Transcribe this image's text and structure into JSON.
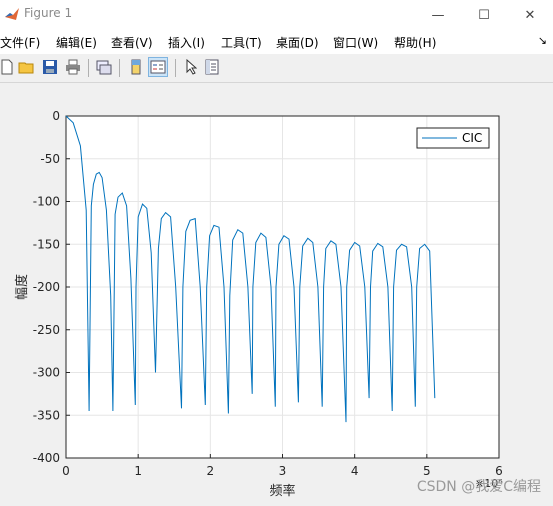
{
  "window": {
    "title": "Figure 1"
  },
  "window_controls": {
    "minimize": "—",
    "maximize": "☐",
    "close": "✕"
  },
  "menu": {
    "items": [
      "文件(F)",
      "编辑(E)",
      "查看(V)",
      "插入(I)",
      "工具(T)",
      "桌面(D)",
      "窗口(W)",
      "帮助(H)"
    ],
    "overflow": "↘"
  },
  "toolbar": {
    "buttons": [
      "new-figure-icon",
      "open-folder-icon",
      "save-icon",
      "print-icon",
      "link-plot-icon",
      "insert-colorbar-icon",
      "insert-legend-icon",
      "edit-plot-pointer-icon",
      "property-inspector-icon"
    ],
    "active": "insert-legend-icon"
  },
  "colors": {
    "line": "#0072bd",
    "grid": "#e6e6e6",
    "axes_bg": "#ffffff"
  },
  "chart_data": {
    "type": "line",
    "xlabel": "频率",
    "ylabel": "幅度",
    "xlim": [
      0,
      6
    ],
    "ylim": [
      -400,
      0
    ],
    "x_ticks": [
      "0",
      "1",
      "2",
      "3",
      "4",
      "5",
      "6"
    ],
    "y_ticks": [
      "0",
      "-50",
      "-100",
      "-150",
      "-200",
      "-250",
      "-300",
      "-350",
      "-400"
    ],
    "x_exponent": "×10⁶",
    "grid": true,
    "legend": {
      "entries": [
        "CIC"
      ],
      "placement": "top-right"
    },
    "series": [
      {
        "name": "CIC",
        "x": [
          0,
          0.1,
          0.2,
          0.28,
          0.32,
          0.35,
          0.38,
          0.42,
          0.46,
          0.5,
          0.56,
          0.62,
          0.65,
          0.68,
          0.72,
          0.78,
          0.84,
          0.9,
          0.96,
          0.97,
          1.0,
          1.06,
          1.12,
          1.18,
          1.24,
          1.28,
          1.32,
          1.38,
          1.45,
          1.52,
          1.6,
          1.62,
          1.66,
          1.72,
          1.79,
          1.86,
          1.93,
          1.95,
          1.99,
          2.05,
          2.12,
          2.19,
          2.25,
          2.27,
          2.31,
          2.38,
          2.45,
          2.52,
          2.58,
          2.59,
          2.63,
          2.7,
          2.77,
          2.84,
          2.9,
          2.91,
          2.95,
          3.02,
          3.09,
          3.16,
          3.22,
          3.24,
          3.28,
          3.35,
          3.42,
          3.49,
          3.55,
          3.57,
          3.6,
          3.67,
          3.74,
          3.81,
          3.88,
          3.89,
          3.93,
          4.0,
          4.07,
          4.14,
          4.2,
          4.22,
          4.25,
          4.32,
          4.39,
          4.46,
          4.52,
          4.54,
          4.58,
          4.65,
          4.72,
          4.79,
          4.84,
          4.86,
          4.9,
          4.97,
          5.04,
          5.11
        ],
        "y": [
          0,
          -8,
          -35,
          -110,
          -345,
          -105,
          -80,
          -68,
          -66,
          -72,
          -110,
          -210,
          -345,
          -115,
          -95,
          -90,
          -105,
          -190,
          -338,
          -200,
          -118,
          -103,
          -108,
          -160,
          -300,
          -155,
          -120,
          -113,
          -118,
          -200,
          -342,
          -200,
          -135,
          -122,
          -120,
          -200,
          -338,
          -200,
          -140,
          -128,
          -130,
          -200,
          -348,
          -210,
          -145,
          -133,
          -137,
          -200,
          -325,
          -200,
          -148,
          -137,
          -142,
          -200,
          -340,
          -200,
          -150,
          -140,
          -144,
          -200,
          -335,
          -200,
          -152,
          -143,
          -148,
          -200,
          -340,
          -200,
          -155,
          -146,
          -150,
          -200,
          -358,
          -200,
          -157,
          -148,
          -152,
          -200,
          -330,
          -200,
          -158,
          -149,
          -153,
          -200,
          -345,
          -200,
          -157,
          -150,
          -153,
          -200,
          -340,
          -200,
          -155,
          -150,
          -158,
          -330
        ]
      }
    ]
  },
  "watermark": "CSDN @我爱C编程"
}
